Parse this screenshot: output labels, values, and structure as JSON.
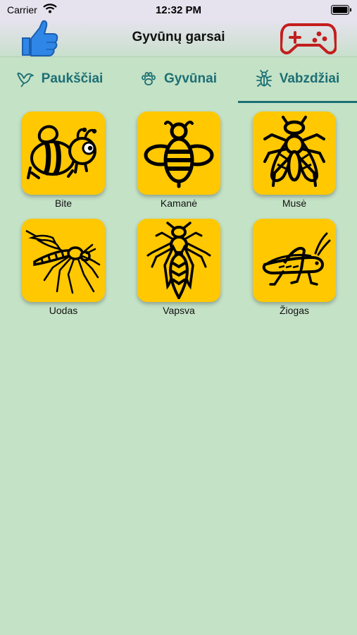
{
  "status_bar": {
    "carrier": "Carrier",
    "time": "12:32 PM"
  },
  "header": {
    "title": "Gyvūnų garsai",
    "like_icon": "thumbs-up-icon",
    "game_icon": "gamepad-icon"
  },
  "tabs": [
    {
      "label": "Paukščiai",
      "icon": "bird-icon",
      "selected": false
    },
    {
      "label": "Gyvūnai",
      "icon": "paw-icon",
      "selected": false
    },
    {
      "label": "Vabzdžiai",
      "icon": "bug-icon",
      "selected": true
    }
  ],
  "items": [
    {
      "label": "Bite",
      "icon": "bee-cartoon-icon"
    },
    {
      "label": "Kamanė",
      "icon": "bumblebee-icon"
    },
    {
      "label": "Musė",
      "icon": "fly-icon"
    },
    {
      "label": "Uodas",
      "icon": "mosquito-icon"
    },
    {
      "label": "Vapsva",
      "icon": "wasp-icon"
    },
    {
      "label": "Žiogas",
      "icon": "grasshopper-icon"
    }
  ],
  "colors": {
    "background": "#c4e2c6",
    "accent": "#1d6f74",
    "tile": "#ffc800",
    "like": "#2f86e6",
    "game": "#c41e1e"
  }
}
